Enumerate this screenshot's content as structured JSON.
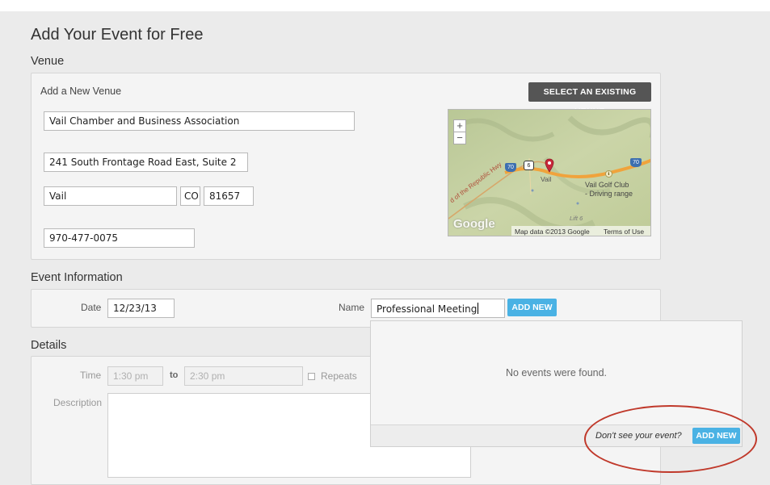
{
  "page_title": "Add Your Event for Free",
  "venue": {
    "section_title": "Venue",
    "subtitle": "Add a New Venue",
    "select_existing_button": "SELECT AN EXISTING VENUE",
    "name": "Vail Chamber and Business Association",
    "address": "241 South Frontage Road East, Suite 2",
    "city": "Vail",
    "state": "CO",
    "zip": "81657",
    "phone": "970-477-0075",
    "map": {
      "zoom_in": "+",
      "zoom_out": "−",
      "place_pin": "Vail",
      "place_golf": "Vail Golf Club",
      "place_golf_sub": "- Driving range",
      "road_label": "d of the Republic Hwy",
      "place_small": "Lift 6",
      "shield_1": "70",
      "shield_2": "6",
      "shield_3": "70",
      "google_logo": "Google",
      "map_data": "Map data ©2013 Google",
      "terms": "Terms of Use"
    }
  },
  "event_info": {
    "section_title": "Event Information",
    "date_label": "Date",
    "date_value": "12/23/13",
    "name_label": "Name",
    "name_value": "Professional Meeting",
    "add_new_button": "ADD NEW"
  },
  "details": {
    "section_title": "Details",
    "time_label": "Time",
    "time_start_placeholder": "1:30 pm",
    "to_label": "to",
    "time_end_placeholder": "2:30 pm",
    "repeats_label": "Repeats",
    "description_label": "Description"
  },
  "dropdown": {
    "empty_message": "No events were found.",
    "prompt": "Don't see your event?",
    "add_new_button": "ADD NEW"
  },
  "colors": {
    "accent_blue": "#4ab2e4",
    "dark_button": "#555555",
    "highlight_circle": "#c0392b"
  }
}
